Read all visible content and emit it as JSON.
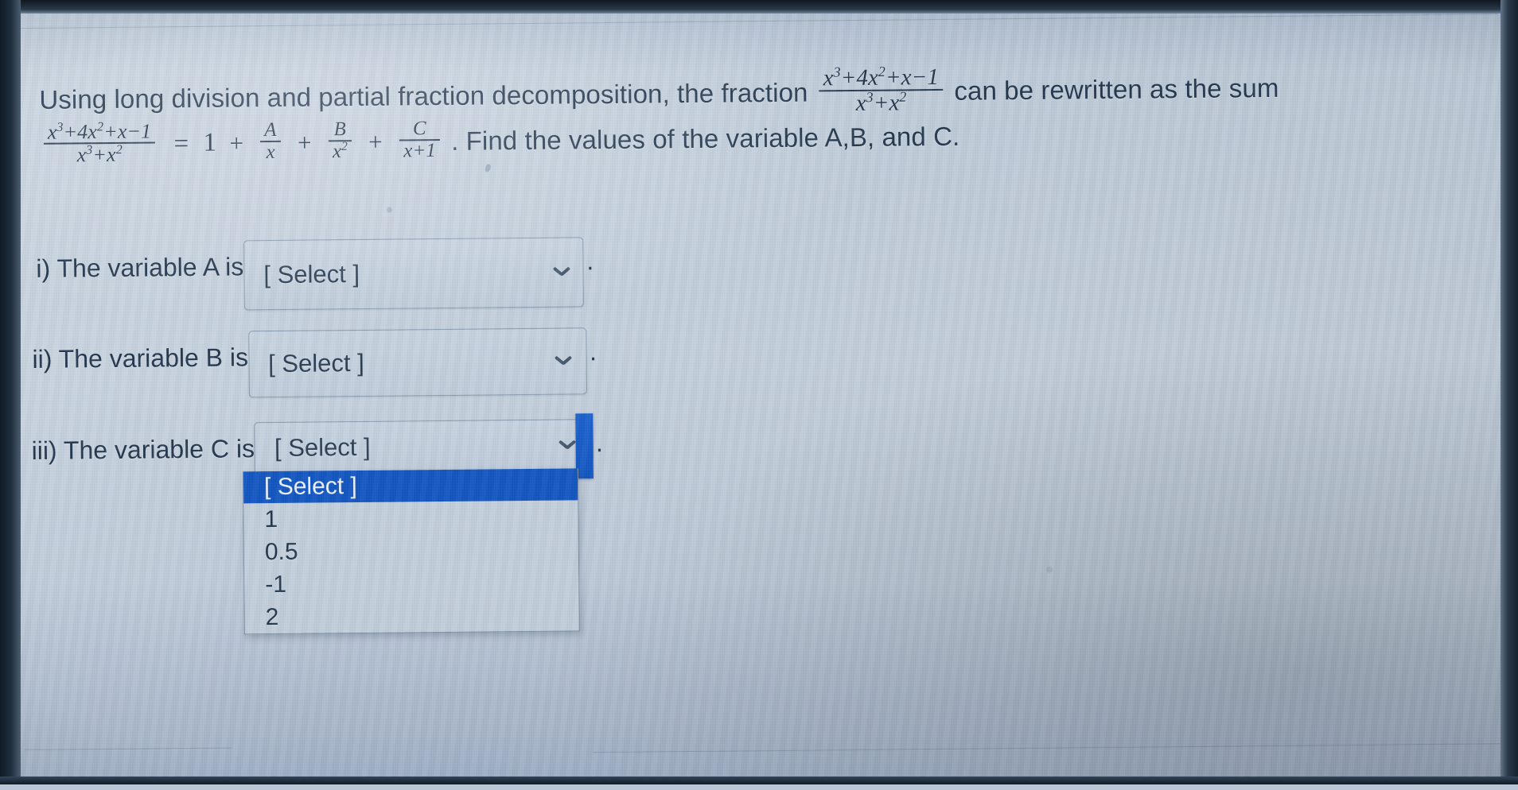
{
  "question": {
    "line1_prefix": "Using long division and partial fraction decomposition, the fraction",
    "inline_fraction": {
      "numerator": "x³+4x²+x−1",
      "denominator": "x³+x²"
    },
    "line1_suffix": "can be rewritten as the sum",
    "equation": {
      "lhs_numerator": "x³+4x²+x−1",
      "lhs_denominator": "x³+x²",
      "equals": "=",
      "term_constant": "1",
      "plus": "+",
      "term_a_numerator": "A",
      "term_a_denominator": "x",
      "term_b_numerator": "B",
      "term_b_denominator": "x²",
      "term_c_numerator": "C",
      "term_c_denominator": "x+1"
    },
    "line2_suffix": ". Find the values of the variable A,B, and C."
  },
  "rows": [
    {
      "label": "i) The variable A is",
      "value": "[ Select ]",
      "trailing": "."
    },
    {
      "label": "ii) The variable B is",
      "value": "[ Select ]",
      "trailing": "."
    },
    {
      "label": "iii) The variable C is",
      "value": "[ Select ]",
      "trailing": "."
    }
  ],
  "dropdown": {
    "open_for": "iii) The variable C is",
    "options": [
      {
        "label": "[ Select ]",
        "selected": true
      },
      {
        "label": "1",
        "selected": false
      },
      {
        "label": "0.5",
        "selected": false
      },
      {
        "label": "-1",
        "selected": false
      },
      {
        "label": "2",
        "selected": false
      }
    ]
  },
  "icons": {
    "chevron_down": "chevron-down-icon"
  },
  "colors": {
    "page_background": "#c2cfdd",
    "text": "#22364e",
    "select_border": "#5c738e",
    "highlight_blue": "#1257c4",
    "highlight_text": "#ecf3fb",
    "bezel": "#1d2a39"
  }
}
